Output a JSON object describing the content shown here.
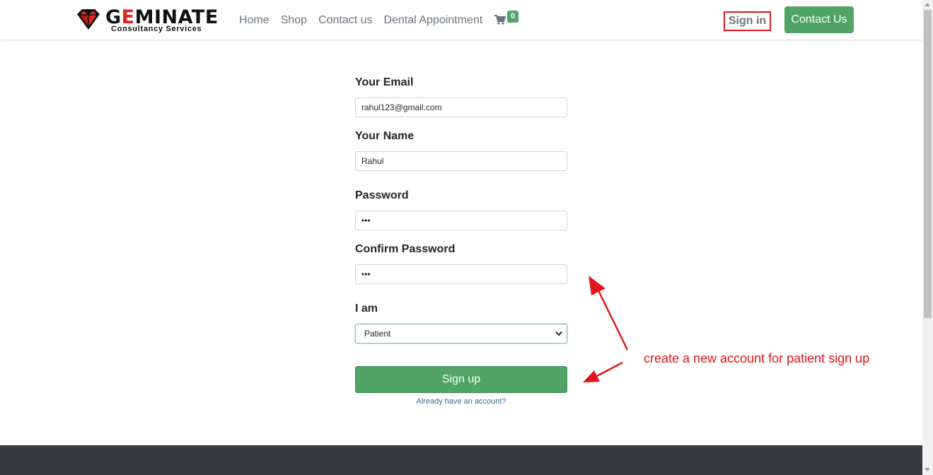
{
  "brand": {
    "name_prefix": "G",
    "name_accent": "E",
    "name_suffix": "MINATE",
    "tagline": "Consultancy Services"
  },
  "nav": {
    "items": [
      {
        "label": "Home"
      },
      {
        "label": "Shop"
      },
      {
        "label": "Contact us"
      },
      {
        "label": "Dental Appointment"
      }
    ],
    "cart_count": "0",
    "signin_label": "Sign in",
    "contact_label": "Contact Us"
  },
  "form": {
    "email_label": "Your Email",
    "email_value": "rahul123@gmail.com",
    "name_label": "Your Name",
    "name_value": "Rahul",
    "password_label": "Password",
    "password_value": "•••",
    "confirm_label": "Confirm Password",
    "confirm_value": "•••",
    "role_label": "I am",
    "role_value": "Patient",
    "signup_label": "Sign up",
    "already_label": "Already have an account?"
  },
  "annotation": {
    "text": "create a new account for patient sign up",
    "color": "#e0161c"
  },
  "colors": {
    "accent_green": "#4fa466",
    "footer": "#343a40"
  }
}
